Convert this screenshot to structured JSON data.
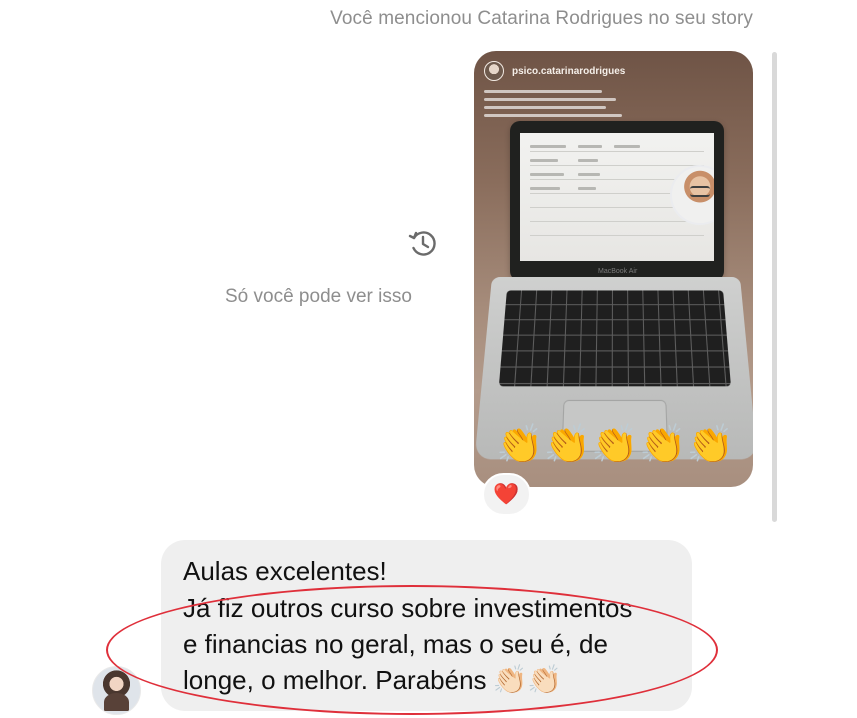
{
  "thread": {
    "mention_note": "Você mencionou Catarina Rodrigues no seu story",
    "private_note": "Só você pode ver isso",
    "story": {
      "handle": "psico.catarinarodrigues",
      "laptop_brand": "MacBook Air",
      "claps": [
        "👏",
        "👏",
        "👏",
        "👏",
        "👏"
      ],
      "reaction": "❤️"
    },
    "message": {
      "lines": [
        "Aulas excelentes!",
        "Já fiz outros curso sobre investimentos",
        "e financias no geral, mas o seu é, de",
        "longe, o melhor. Parabéns"
      ],
      "emoji": "👏🏻👏🏻"
    }
  },
  "icons": {
    "history": "history-icon",
    "avatar": "profile-avatar"
  },
  "colors": {
    "muted_text": "#8e8e8e",
    "bubble_bg": "#efefef",
    "heart": "#ed2447",
    "annotation": "#df2f3a"
  }
}
